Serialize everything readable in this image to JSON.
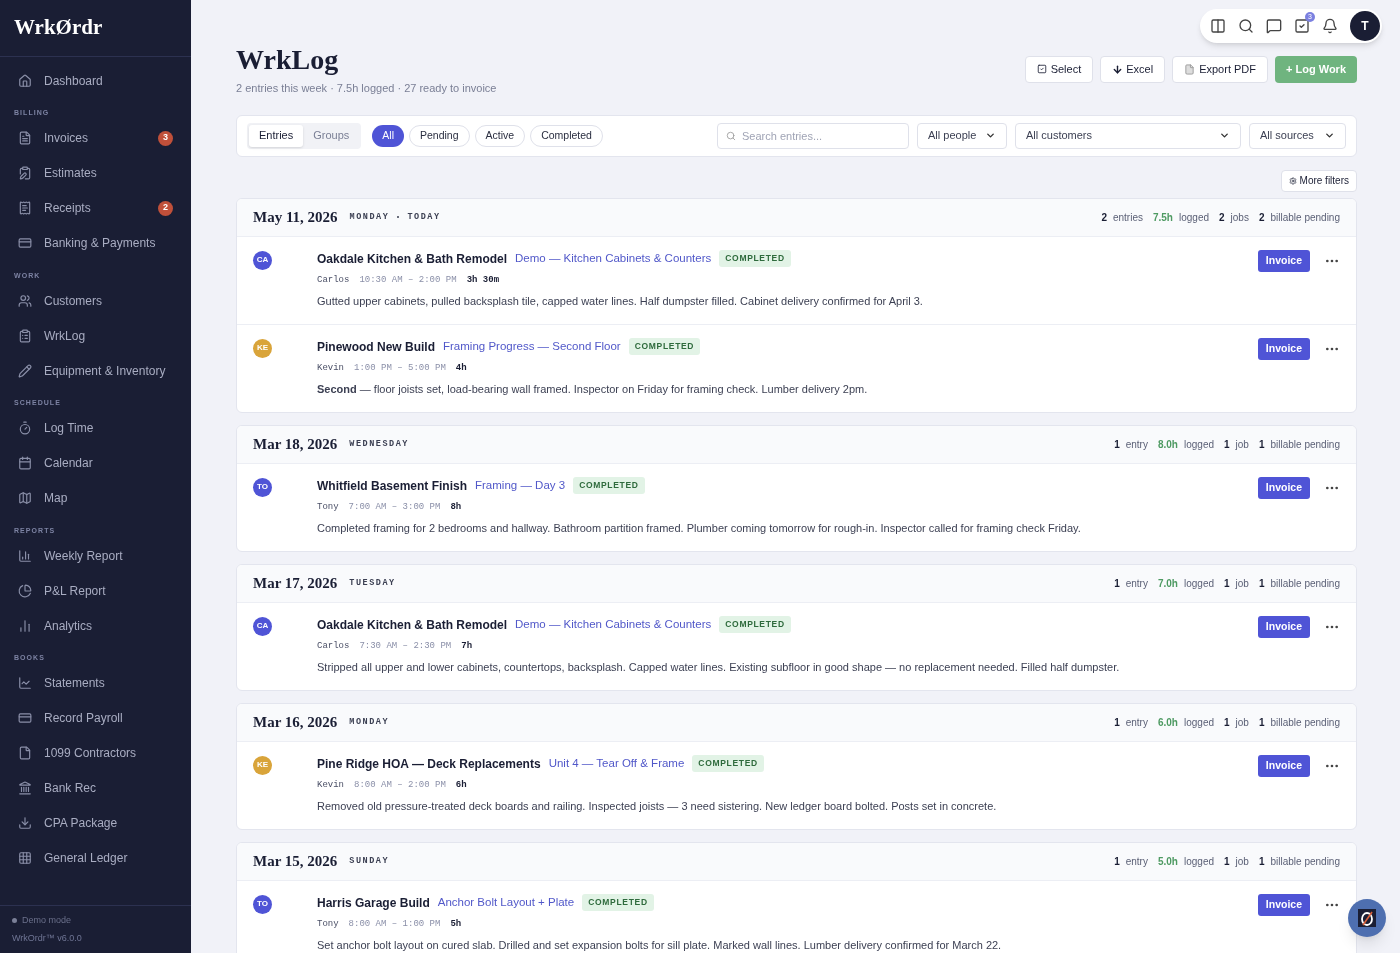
{
  "sidebar": {
    "logo": "WrkØrdr",
    "top_items": [
      {
        "label": "Dashboard"
      }
    ],
    "sections": [
      {
        "title": "BILLING",
        "items": [
          {
            "label": "Invoices",
            "badge": "3"
          },
          {
            "label": "Estimates"
          },
          {
            "label": "Receipts",
            "badge": "2"
          },
          {
            "label": "Banking & Payments"
          }
        ]
      },
      {
        "title": "WORK",
        "items": [
          {
            "label": "Customers"
          },
          {
            "label": "WrkLog"
          },
          {
            "label": "Equipment & Inventory"
          }
        ]
      },
      {
        "title": "SCHEDULE",
        "items": [
          {
            "label": "Log Time"
          },
          {
            "label": "Calendar"
          },
          {
            "label": "Map"
          }
        ]
      },
      {
        "title": "REPORTS",
        "items": [
          {
            "label": "Weekly Report"
          },
          {
            "label": "P&L Report"
          },
          {
            "label": "Analytics"
          }
        ]
      },
      {
        "title": "BOOKS",
        "items": [
          {
            "label": "Statements"
          },
          {
            "label": "Record Payroll"
          },
          {
            "label": "1099 Contractors"
          },
          {
            "label": "Bank Rec"
          },
          {
            "label": "CPA Package"
          },
          {
            "label": "General Ledger"
          }
        ]
      }
    ],
    "footer": {
      "mode": "Demo mode",
      "version": "WrkOrdr™ v6.0.0"
    }
  },
  "topbar": {
    "tasks_badge": "3",
    "avatar": "T"
  },
  "header": {
    "title": "WrkLog",
    "subtitle": "2 entries this week · 7.5h logged · 27 ready to invoice",
    "buttons": [
      {
        "label": "Select",
        "kind": "select"
      },
      {
        "label": "Excel",
        "kind": "excel"
      },
      {
        "label": "Export PDF",
        "kind": "pdf"
      },
      {
        "label": "+ Log Work",
        "kind": "primary"
      }
    ]
  },
  "filters": {
    "views": [
      {
        "label": "Entries",
        "selected": true
      },
      {
        "label": "Groups",
        "selected": false
      }
    ],
    "statuses": [
      {
        "label": "All",
        "selected": true
      },
      {
        "label": "Pending",
        "selected": false
      },
      {
        "label": "Active",
        "selected": false
      },
      {
        "label": "Completed",
        "selected": false
      }
    ],
    "search": {
      "placeholder": "Search entries..."
    },
    "selects": [
      "All people",
      "All customers",
      "All sources"
    ],
    "more": "More filters"
  },
  "days": [
    {
      "date": "May 11, 2026",
      "tags": [
        "MONDAY",
        "TODAY"
      ],
      "stats": [
        {
          "n": "2",
          "label": "entries"
        },
        {
          "n": "7.5h",
          "label": "logged",
          "kind": "hours"
        },
        {
          "n": "2",
          "label": "jobs"
        },
        {
          "n": "2",
          "label": "billable pending"
        }
      ],
      "entries": [
        {
          "initials": "CA",
          "color": "#4f54d6",
          "project": "Oakdale Kitchen & Bath Remodel",
          "task": "Demo — Kitchen Cabinets & Counters",
          "status": "COMPLETED",
          "person": "Carlos",
          "time": "10:30 AM – 2:00 PM",
          "duration": "3h 30m",
          "note": "Gutted upper cabinets, pulled backsplash tile, capped water lines. Half dumpster filled. Cabinet delivery confirmed for April 3.",
          "action": "Invoice"
        },
        {
          "initials": "KE",
          "color": "#d9a43a",
          "project": "Pinewood New Build",
          "task": "Framing Progress — Second Floor",
          "status": "COMPLETED",
          "person": "Kevin",
          "time": "1:00 PM – 5:00 PM",
          "duration": "4h",
          "note": "**Second** — floor joists set, load-bearing wall framed. Inspector on Friday for framing check. Lumber delivery 2pm.",
          "action": "Invoice"
        }
      ]
    },
    {
      "date": "Mar 18, 2026",
      "tags": [
        "WEDNESDAY"
      ],
      "stats": [
        {
          "n": "1",
          "label": "entry"
        },
        {
          "n": "8.0h",
          "label": "logged",
          "kind": "hours"
        },
        {
          "n": "1",
          "label": "job"
        },
        {
          "n": "1",
          "label": "billable pending"
        }
      ],
      "entries": [
        {
          "initials": "TO",
          "color": "#4f54d6",
          "project": "Whitfield Basement Finish",
          "task": "Framing — Day 3",
          "status": "COMPLETED",
          "person": "Tony",
          "time": "7:00 AM – 3:00 PM",
          "duration": "8h",
          "note": "Completed framing for 2 bedrooms and hallway. Bathroom partition framed. Plumber coming tomorrow for rough-in. Inspector called for framing check Friday.",
          "action": "Invoice"
        }
      ]
    },
    {
      "date": "Mar 17, 2026",
      "tags": [
        "TUESDAY"
      ],
      "stats": [
        {
          "n": "1",
          "label": "entry"
        },
        {
          "n": "7.0h",
          "label": "logged",
          "kind": "hours"
        },
        {
          "n": "1",
          "label": "job"
        },
        {
          "n": "1",
          "label": "billable pending"
        }
      ],
      "entries": [
        {
          "initials": "CA",
          "color": "#4f54d6",
          "project": "Oakdale Kitchen & Bath Remodel",
          "task": "Demo — Kitchen Cabinets & Counters",
          "status": "COMPLETED",
          "person": "Carlos",
          "time": "7:30 AM – 2:30 PM",
          "duration": "7h",
          "note": "Stripped all upper and lower cabinets, countertops, backsplash. Capped water lines. Existing subfloor in good shape — no replacement needed. Filled half dumpster.",
          "action": "Invoice"
        }
      ]
    },
    {
      "date": "Mar 16, 2026",
      "tags": [
        "MONDAY"
      ],
      "stats": [
        {
          "n": "1",
          "label": "entry"
        },
        {
          "n": "6.0h",
          "label": "logged",
          "kind": "hours"
        },
        {
          "n": "1",
          "label": "job"
        },
        {
          "n": "1",
          "label": "billable pending"
        }
      ],
      "entries": [
        {
          "initials": "KE",
          "color": "#d9a43a",
          "project": "Pine Ridge HOA — Deck Replacements",
          "task": "Unit 4 — Tear Off & Frame",
          "status": "COMPLETED",
          "person": "Kevin",
          "time": "8:00 AM – 2:00 PM",
          "duration": "6h",
          "note": "Removed old pressure-treated deck boards and railing. Inspected joists — 3 need sistering. New ledger board bolted. Posts set in concrete.",
          "action": "Invoice"
        }
      ]
    },
    {
      "date": "Mar 15, 2026",
      "tags": [
        "SUNDAY"
      ],
      "stats": [
        {
          "n": "1",
          "label": "entry"
        },
        {
          "n": "5.0h",
          "label": "logged",
          "kind": "hours"
        },
        {
          "n": "1",
          "label": "job"
        },
        {
          "n": "1",
          "label": "billable pending"
        }
      ],
      "entries": [
        {
          "initials": "TO",
          "color": "#4f54d6",
          "project": "Harris Garage Build",
          "task": "Anchor Bolt Layout + Plate",
          "status": "COMPLETED",
          "person": "Tony",
          "time": "8:00 AM – 1:00 PM",
          "duration": "5h",
          "note": "Set anchor bolt layout on cured slab. Drilled and set expansion bolts for sill plate. Marked wall lines. Lumber delivery confirmed for March 22.",
          "action": "Invoice"
        }
      ]
    }
  ]
}
